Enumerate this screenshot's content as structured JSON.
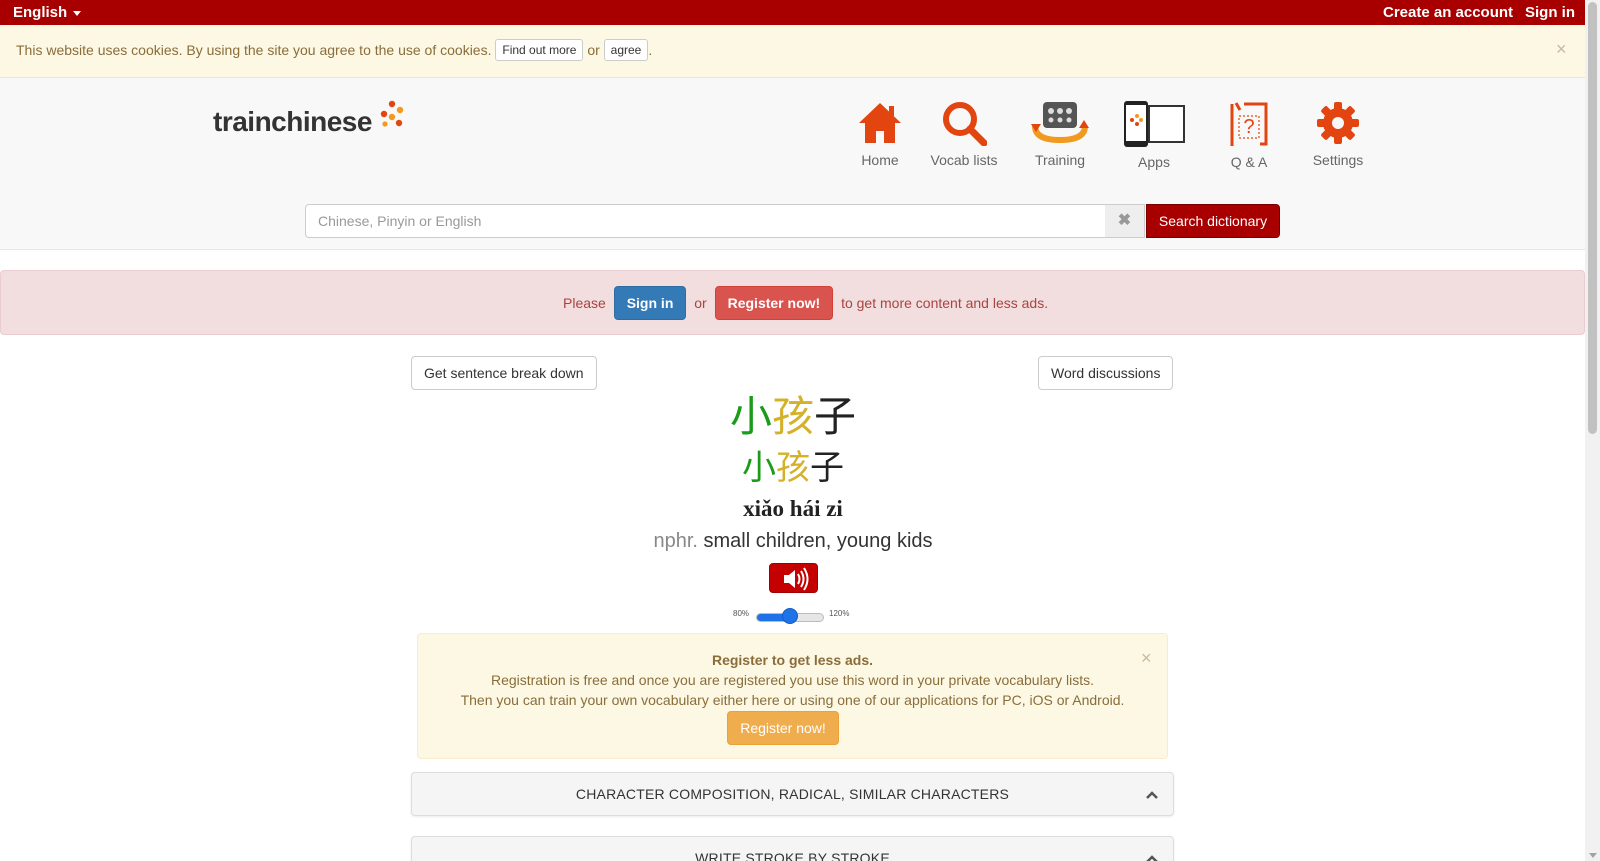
{
  "topbar": {
    "language": "English",
    "create_account": "Create an account",
    "sign_in": "Sign in"
  },
  "cookie": {
    "message": "This website uses cookies. By using the site you agree to the use of cookies.",
    "find_out_more": "Find out more",
    "or": "or",
    "agree": "agree",
    "period": ".",
    "close": "×"
  },
  "header": {
    "logo_text": "trainchinese",
    "nav": [
      {
        "label": "Home",
        "icon": "home-icon"
      },
      {
        "label": "Vocab lists",
        "icon": "search-icon"
      },
      {
        "label": "Training",
        "icon": "training-icon"
      },
      {
        "label": "Apps",
        "icon": "devices-icon"
      },
      {
        "label": "Q & A",
        "icon": "question-icon"
      },
      {
        "label": "Settings",
        "icon": "gear-icon"
      }
    ],
    "search": {
      "placeholder": "Chinese, Pinyin or English",
      "value": "",
      "clear": "✖",
      "button": "Search dictionary"
    }
  },
  "signin_banner": {
    "please": "Please",
    "sign_in": "Sign in",
    "or": "or",
    "register": "Register now!",
    "suffix": "to get more content and less ads."
  },
  "word": {
    "sentence_breakdown": "Get sentence break down",
    "discussions": "Word discussions",
    "chars": [
      "小",
      "孩",
      "子"
    ],
    "pinyin": "xiǎo hái zi",
    "pos": "nphr.",
    "definition": "small children, young kids",
    "audio_icon": "speaker-icon",
    "speed_min": "80%",
    "speed_max": "120%",
    "speed_value": 0.5
  },
  "register_box": {
    "title": "Register to get less ads.",
    "line1": "Registration is free and once you are registered you use this word in your private vocabulary lists.",
    "line2": "Then you can train your own vocabulary either here or using one of our applications for PC, iOS or Android.",
    "button": "Register now!",
    "close": "×"
  },
  "panels": [
    {
      "label": "CHARACTER COMPOSITION, RADICAL, SIMILAR CHARACTERS"
    },
    {
      "label": "WRITE STROKE BY STROKE"
    }
  ],
  "colors": {
    "brand": "#a80000",
    "char_1": "#1a9b1a",
    "char_2": "#d4b12b",
    "char_3": "#222222",
    "icon_orange": "#e2450f"
  }
}
